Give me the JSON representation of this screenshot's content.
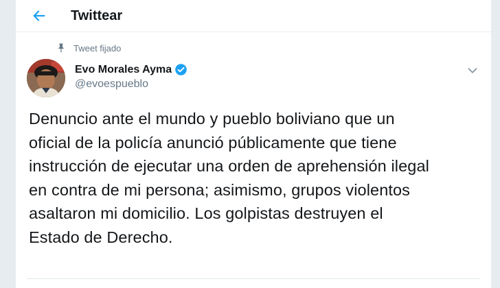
{
  "header": {
    "title": "Twittear"
  },
  "tweet": {
    "pinned_label": "Tweet fijado",
    "author": {
      "name": "Evo Morales Ayma",
      "handle": "@evoespueblo"
    },
    "text_lines": [
      "Denuncio ante el mundo y pueblo boliviano que un",
      "oficial de la policía anunció públicamente que tiene",
      "instrucción de ejecutar una orden de aprehensión ilegal",
      "en contra de mi persona; asimismo, grupos violentos",
      "asaltaron mi domicilio. Los golpistas destruyen el",
      "Estado de Derecho."
    ]
  },
  "icons": {
    "back": "arrow-left-icon",
    "pin": "pin-icon",
    "verified": "verified-badge-icon",
    "menu": "chevron-down-icon"
  },
  "colors": {
    "accent": "#1da1f2",
    "text": "#14171a",
    "secondary": "#657786",
    "border": "#e6ecf0"
  }
}
